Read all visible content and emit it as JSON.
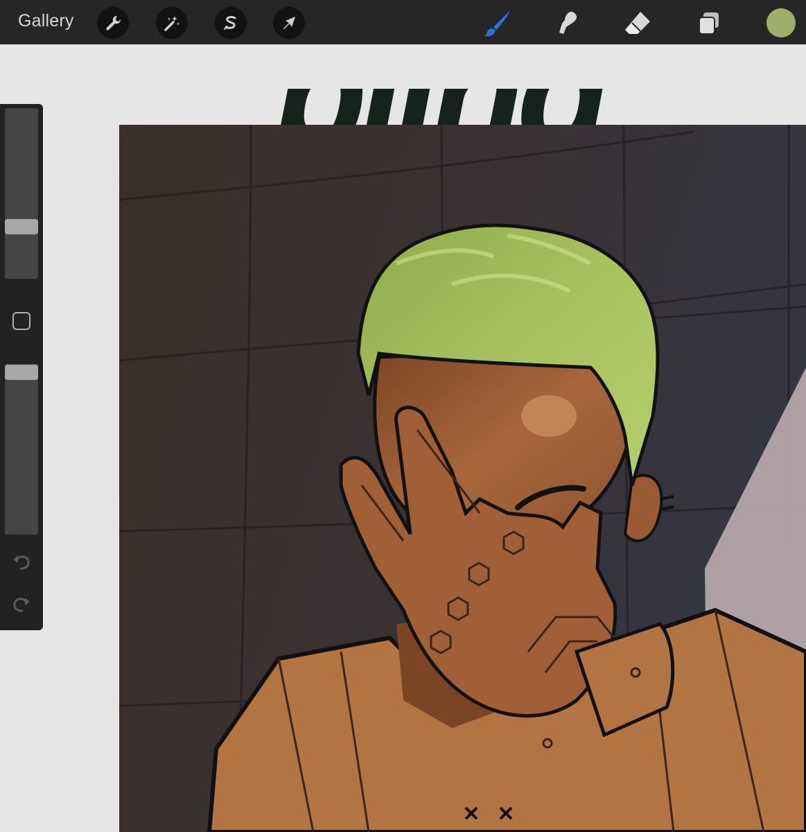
{
  "app": {
    "gallery_label": "Gallery"
  },
  "toolbar": {
    "left_tools": [
      {
        "name": "actions",
        "icon": "wrench-icon"
      },
      {
        "name": "adjustments",
        "icon": "magic-wand-icon"
      },
      {
        "name": "selection",
        "icon": "selection-s-icon"
      },
      {
        "name": "transform",
        "icon": "arrow-cursor-icon"
      }
    ],
    "right_tools": [
      {
        "name": "brush",
        "icon": "brush-icon",
        "active": true
      },
      {
        "name": "smudge",
        "icon": "smudge-icon"
      },
      {
        "name": "eraser",
        "icon": "eraser-icon"
      },
      {
        "name": "layers",
        "icon": "layers-icon"
      }
    ],
    "current_color": "#9fae6a",
    "active_color": "#2d6fe0"
  },
  "canvas": {
    "title_text": "blind"
  },
  "sidebar": {
    "brush_size_level": 0.35,
    "opacity_level": 0.97
  },
  "colors": {
    "toolbar_bg": "#262626",
    "canvas_bg": "#e6e6e6",
    "title_color": "#15231c",
    "hair": "#a9c15f",
    "skin": "#a8673b",
    "shirt": "#b27443",
    "wall_warm": "#7a5f51",
    "wall_cool": "#6d6d80"
  }
}
